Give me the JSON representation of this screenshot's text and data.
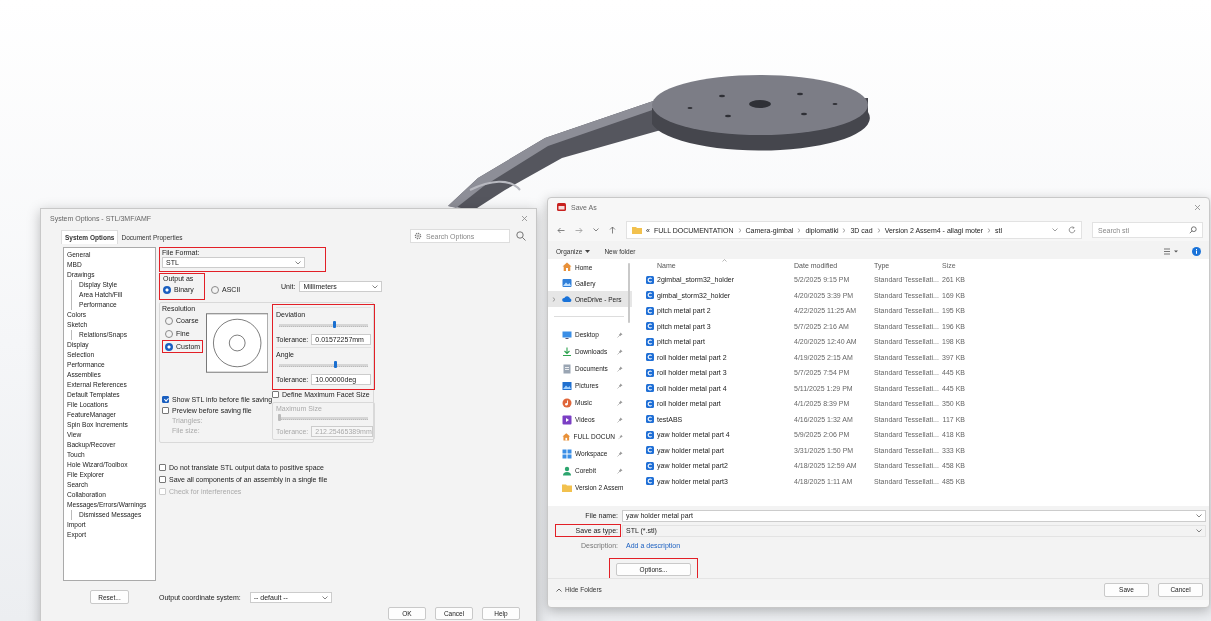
{
  "viewport": {
    "kind": "cad-part"
  },
  "system_options": {
    "title": "System Options - STL/3MF/AMF",
    "tabs": [
      {
        "label": "System Options",
        "selected": true
      },
      {
        "label": "Document Properties",
        "selected": false
      }
    ],
    "search": {
      "placeholder": "Search Options"
    },
    "tree": [
      {
        "label": "General"
      },
      {
        "label": "MBD"
      },
      {
        "label": "Drawings",
        "children": [
          {
            "label": "Display Style"
          },
          {
            "label": "Area Hatch/Fill"
          },
          {
            "label": "Performance"
          }
        ]
      },
      {
        "label": "Colors"
      },
      {
        "label": "Sketch",
        "children": [
          {
            "label": "Relations/Snaps"
          }
        ]
      },
      {
        "label": "Display"
      },
      {
        "label": "Selection"
      },
      {
        "label": "Performance"
      },
      {
        "label": "Assemblies"
      },
      {
        "label": "External References"
      },
      {
        "label": "Default Templates"
      },
      {
        "label": "File Locations"
      },
      {
        "label": "FeatureManager"
      },
      {
        "label": "Spin Box Increments"
      },
      {
        "label": "View"
      },
      {
        "label": "Backup/Recover"
      },
      {
        "label": "Touch"
      },
      {
        "label": "Hole Wizard/Toolbox"
      },
      {
        "label": "File Explorer"
      },
      {
        "label": "Search"
      },
      {
        "label": "Collaboration"
      },
      {
        "label": "Messages/Errors/Warnings",
        "children": [
          {
            "label": "Dismissed Messages"
          }
        ]
      },
      {
        "label": "Import"
      },
      {
        "label": "Export"
      }
    ],
    "reset_button": "Reset...",
    "file_format": {
      "label": "File Format:",
      "value": "STL",
      "highlighted": true
    },
    "output_as": {
      "label": "Output as",
      "highlighted": true,
      "options": [
        {
          "label": "Binary",
          "selected": true
        },
        {
          "label": "ASCII",
          "selected": false
        }
      ]
    },
    "unit": {
      "label": "Unit:",
      "value": "Millimeters"
    },
    "resolution": {
      "label": "Resolution",
      "options": [
        {
          "label": "Coarse",
          "selected": false,
          "highlighted": false
        },
        {
          "label": "Fine",
          "selected": false,
          "highlighted": false
        },
        {
          "label": "Custom",
          "selected": true,
          "highlighted": true
        }
      ]
    },
    "tolerances": {
      "highlighted": true,
      "groups": [
        {
          "label": "Deviation",
          "level": 0.62,
          "tolerance_label": "Tolerance:",
          "tolerance": "0.01572257mm"
        },
        {
          "label": "Angle",
          "level": 0.64,
          "tolerance_label": "Tolerance:",
          "tolerance": "10.00000deg"
        }
      ]
    },
    "preview_checks": [
      {
        "label": "Show STL info before file saving",
        "checked": true
      },
      {
        "label": "Preview before saving file",
        "checked": false
      }
    ],
    "preview_info": [
      "Triangles:",
      "File size:"
    ],
    "facet": {
      "label": "Define Maximum Facet Size",
      "checked": false,
      "group_label": "Maximum Size",
      "level": 0,
      "tolerance_label": "Tolerance:",
      "tolerance": "212.25465389mm"
    },
    "options": [
      {
        "label": "Do not translate STL output data to positive space",
        "checked": false,
        "disabled": false
      },
      {
        "label": "Save all components of an assembly in a single file",
        "checked": false,
        "disabled": false
      },
      {
        "label": "Check for interferences",
        "checked": false,
        "disabled": true
      }
    ],
    "coordinate_system": {
      "label": "Output coordinate system:",
      "value": "-- default --"
    },
    "buttons": [
      "OK",
      "Cancel",
      "Help"
    ]
  },
  "save_as": {
    "title": "Save As",
    "address": {
      "overflow": "«",
      "parts": [
        "FULL DOCUMENTATION",
        "Camera-gimbal",
        "diplomatiki",
        "3D cad",
        "Version 2 Assem4 - allagi moter",
        "stl"
      ]
    },
    "search": {
      "placeholder": "Search stl"
    },
    "toolbar": {
      "organize": "Organize",
      "new_folder": "New folder"
    },
    "nav_top": [
      {
        "label": "Home",
        "kind": "home",
        "selected": false,
        "expandable": false
      },
      {
        "label": "Gallery",
        "kind": "gallery",
        "selected": false,
        "expandable": false
      },
      {
        "label": "OneDrive - Pers",
        "kind": "cloud",
        "selected": true,
        "expandable": true
      }
    ],
    "nav_quick": [
      {
        "label": "Desktop",
        "kind": "desktop",
        "pinned": true
      },
      {
        "label": "Downloads",
        "kind": "download",
        "pinned": true
      },
      {
        "label": "Documents",
        "kind": "documents",
        "pinned": true
      },
      {
        "label": "Pictures",
        "kind": "pictures",
        "pinned": true
      },
      {
        "label": "Music",
        "kind": "music",
        "pinned": true
      },
      {
        "label": "Videos",
        "kind": "videos",
        "pinned": true
      },
      {
        "label": "FULL DOCUN",
        "kind": "home",
        "pinned": true
      },
      {
        "label": "Workspace",
        "kind": "workspace",
        "pinned": true
      },
      {
        "label": "Corebit",
        "kind": "user",
        "pinned": true
      },
      {
        "label": "Version 2 Assem",
        "kind": "folder",
        "pinned": false
      }
    ],
    "columns": [
      "Name",
      "Date modified",
      "Type",
      "Size"
    ],
    "files": [
      {
        "name": "2gimbal_storm32_holder",
        "date": "5/2/2025 9:15 PM",
        "type": "Standard Tessellati...",
        "size": "261 KB"
      },
      {
        "name": "gimbal_storm32_holder",
        "date": "4/20/2025 3:39 PM",
        "type": "Standard Tessellati...",
        "size": "169 KB"
      },
      {
        "name": "pitch metal part 2",
        "date": "4/22/2025 11:25 AM",
        "type": "Standard Tessellati...",
        "size": "195 KB"
      },
      {
        "name": "pitch metal part 3",
        "date": "5/7/2025 2:16 AM",
        "type": "Standard Tessellati...",
        "size": "196 KB"
      },
      {
        "name": "pitch metal part",
        "date": "4/20/2025 12:40 AM",
        "type": "Standard Tessellati...",
        "size": "198 KB"
      },
      {
        "name": "roll holder metal part 2",
        "date": "4/19/2025 2:15 AM",
        "type": "Standard Tessellati...",
        "size": "397 KB"
      },
      {
        "name": "roll holder metal part 3",
        "date": "5/7/2025 7:54 PM",
        "type": "Standard Tessellati...",
        "size": "445 KB"
      },
      {
        "name": "roll holder metal part 4",
        "date": "5/11/2025 1:29 PM",
        "type": "Standard Tessellati...",
        "size": "445 KB"
      },
      {
        "name": "roll holder metal part",
        "date": "4/1/2025 8:39 PM",
        "type": "Standard Tessellati...",
        "size": "350 KB"
      },
      {
        "name": "testABS",
        "date": "4/16/2025 1:32 AM",
        "type": "Standard Tessellati...",
        "size": "117 KB"
      },
      {
        "name": "yaw holder metal part 4",
        "date": "5/9/2025 2:06 PM",
        "type": "Standard Tessellati...",
        "size": "418 KB"
      },
      {
        "name": "yaw holder metal part",
        "date": "3/31/2025 1:50 PM",
        "type": "Standard Tessellati...",
        "size": "333 KB"
      },
      {
        "name": "yaw holder metal part2",
        "date": "4/18/2025 12:59 AM",
        "type": "Standard Tessellati...",
        "size": "458 KB"
      },
      {
        "name": "yaw holder metal part3",
        "date": "4/18/2025 1:11 AM",
        "type": "Standard Tessellati...",
        "size": "485 KB"
      }
    ],
    "file_name": {
      "label": "File name:",
      "value": "yaw holder metal part",
      "highlighted": false
    },
    "save_as_type": {
      "label": "Save as type:",
      "value": "STL (*.stl)",
      "highlighted": true
    },
    "description": {
      "label": "Description:",
      "link": "Add a description"
    },
    "options_button": {
      "label": "Options...",
      "highlighted": true
    },
    "hide_folders": "Hide Folders",
    "buttons": [
      "Save",
      "Cancel"
    ]
  }
}
